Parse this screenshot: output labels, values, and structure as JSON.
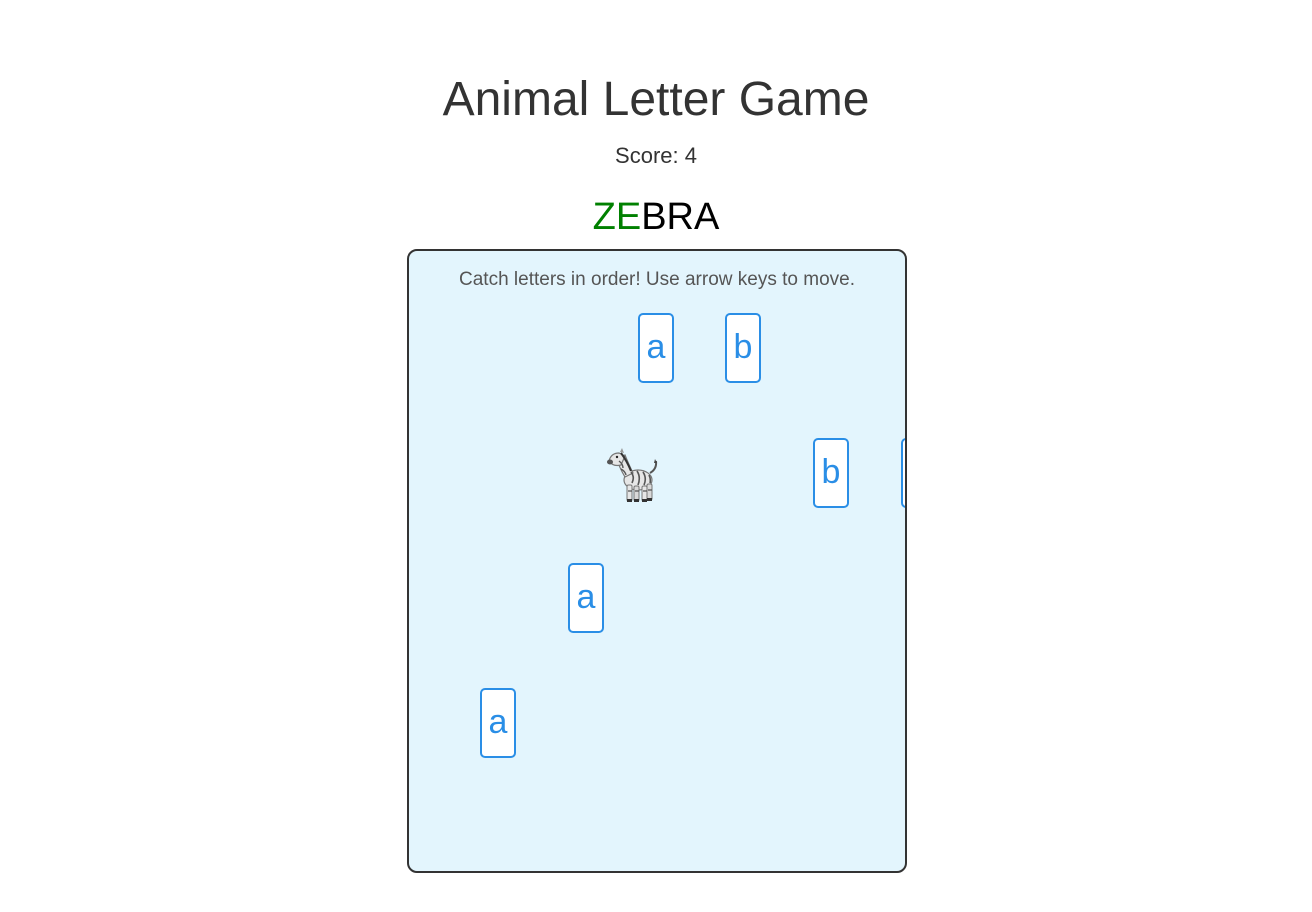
{
  "title": "Animal Letter Game",
  "score": {
    "label": "Score: 4",
    "value": 4
  },
  "target_word": {
    "word": "ZEBRA",
    "caught": "ZE",
    "remaining": "BRA",
    "caught_color": "#008000",
    "remaining_color": "#000000"
  },
  "board": {
    "instructions": "Catch letters in order! Use arrow keys to move.",
    "background": "#e3f5fd",
    "player": {
      "animal": "zebra",
      "icon": "zebra-icon"
    },
    "falling_letters": [
      {
        "letter": "a"
      },
      {
        "letter": "b"
      },
      {
        "letter": "b"
      },
      {
        "letter": ""
      },
      {
        "letter": "a"
      },
      {
        "letter": "a"
      }
    ],
    "letter_color": "#2a8ee6"
  }
}
